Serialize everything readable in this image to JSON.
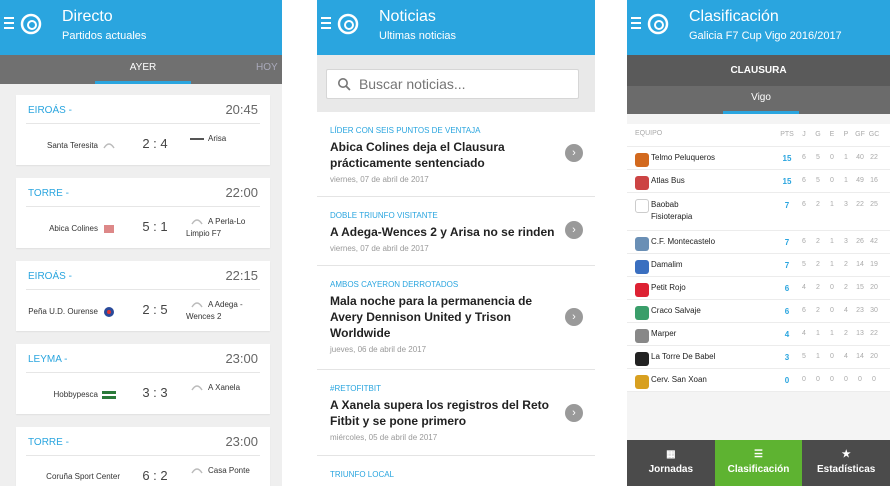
{
  "colors": {
    "accent": "#2aa5df",
    "active_nav": "#5eb331"
  },
  "directo": {
    "title": "Directo",
    "subtitle": "Partidos actuales",
    "tab_active": "AYER",
    "tab_next": "HOY",
    "matches": [
      {
        "venue": "EIROÁS -",
        "time": "20:45",
        "home": "Santa Teresita",
        "score": "2 : 4",
        "away": "Arisa"
      },
      {
        "venue": "TORRE -",
        "time": "22:00",
        "home": "Abica Colines",
        "score": "5 : 1",
        "away": "A Perla-Lo Limpio F7"
      },
      {
        "venue": "EIROÁS -",
        "time": "22:15",
        "home": "Peña U.D. Ourense",
        "score": "2 : 5",
        "away": "A Adega - Wences 2"
      },
      {
        "venue": "LEYMA -",
        "time": "23:00",
        "home": "Hobbypesca",
        "score": "3 : 3",
        "away": "A Xanela"
      },
      {
        "venue": "TORRE -",
        "time": "23:00",
        "home": "Coruña Sport Center",
        "score": "6 : 2",
        "away": "Casa Ponte"
      }
    ]
  },
  "noticias": {
    "title": "Noticias",
    "subtitle": "Ultimas noticias",
    "search_placeholder": "Buscar noticias...",
    "items": [
      {
        "kicker": "LÍDER CON SEIS PUNTOS DE VENTAJA",
        "headline": "Abica Colines deja el Clausura prácticamente sentenciado",
        "date": "viernes, 07 de abril de 2017"
      },
      {
        "kicker": "DOBLE TRIUNFO VISITANTE",
        "headline": "A Adega-Wences 2 y Arisa no se rinden",
        "date": "viernes, 07 de abril de 2017"
      },
      {
        "kicker": "AMBOS CAYERON DERROTADOS",
        "headline": "Mala noche para la permanencia de Avery Dennison United y Trison Worldwide",
        "date": "jueves, 06 de abril de 2017"
      },
      {
        "kicker": "#RETOFITBIT",
        "headline": "A Xanela supera los registros del Reto Fitbit y se pone primero",
        "date": "miércoles, 05 de abril de 2017"
      },
      {
        "kicker": "TRIUNFO LOCAL",
        "headline": "",
        "date": ""
      }
    ]
  },
  "clasificacion": {
    "title": "Clasificación",
    "subtitle": "Galicia F7 Cup Vigo 2016/2017",
    "phase": "CLAUSURA",
    "group_tab": "Vigo",
    "headers": {
      "team": "EQUIPO",
      "pts": "PTS",
      "j": "J",
      "g": "G",
      "e": "E",
      "p": "P",
      "gf": "GF",
      "gc": "GC"
    },
    "rows": [
      {
        "team": "Telmo Peluqueros",
        "pts": "15",
        "j": "6",
        "g": "5",
        "e": "0",
        "p": "1",
        "gf": "40",
        "gc": "22"
      },
      {
        "team": "Atlas Bus",
        "pts": "15",
        "j": "6",
        "g": "5",
        "e": "0",
        "p": "1",
        "gf": "49",
        "gc": "16"
      },
      {
        "team": "Baobab Fisioterapia",
        "pts": "7",
        "j": "6",
        "g": "2",
        "e": "1",
        "p": "3",
        "gf": "22",
        "gc": "25"
      },
      {
        "team": "C.F. Montecastelo",
        "pts": "7",
        "j": "6",
        "g": "2",
        "e": "1",
        "p": "3",
        "gf": "26",
        "gc": "42"
      },
      {
        "team": "Damalim",
        "pts": "7",
        "j": "5",
        "g": "2",
        "e": "1",
        "p": "2",
        "gf": "14",
        "gc": "19"
      },
      {
        "team": "Petit Rojo",
        "pts": "6",
        "j": "4",
        "g": "2",
        "e": "0",
        "p": "2",
        "gf": "15",
        "gc": "20"
      },
      {
        "team": "Craco Salvaje",
        "pts": "6",
        "j": "6",
        "g": "2",
        "e": "0",
        "p": "4",
        "gf": "23",
        "gc": "30"
      },
      {
        "team": "Marper",
        "pts": "4",
        "j": "4",
        "g": "1",
        "e": "1",
        "p": "2",
        "gf": "13",
        "gc": "22"
      },
      {
        "team": "La Torre De Babel",
        "pts": "3",
        "j": "5",
        "g": "1",
        "e": "0",
        "p": "4",
        "gf": "14",
        "gc": "20"
      },
      {
        "team": "Cerv. San Xoan",
        "pts": "0",
        "j": "0",
        "g": "0",
        "e": "0",
        "p": "0",
        "gf": "0",
        "gc": "0"
      }
    ],
    "nav": [
      {
        "label": "Jornadas",
        "icon": "calendar-icon"
      },
      {
        "label": "Clasificación",
        "icon": "list-icon"
      },
      {
        "label": "Estadísticas",
        "icon": "star-icon"
      }
    ]
  }
}
